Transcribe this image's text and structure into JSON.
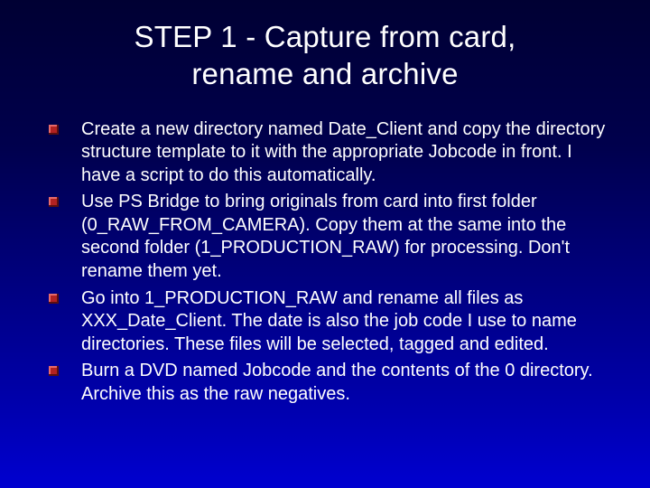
{
  "slide": {
    "title": "STEP 1 - Capture from card, rename and archive",
    "bullets": [
      "Create a new directory named Date_Client and copy the directory structure template to it with the appropriate Jobcode in front.   I have a script to do this automatically.",
      "Use PS Bridge to bring originals from card into first folder (0_RAW_FROM_CAMERA).  Copy them at the same into the second folder (1_PRODUCTION_RAW) for processing.  Don't rename them yet.",
      "Go into 1_PRODUCTION_RAW and rename all files as XXX_Date_Client.  The date is also the job code I use to name directories.  These files will be selected, tagged and edited.",
      "Burn a DVD named Jobcode and the contents of the 0 directory.  Archive this as the raw negatives."
    ]
  }
}
